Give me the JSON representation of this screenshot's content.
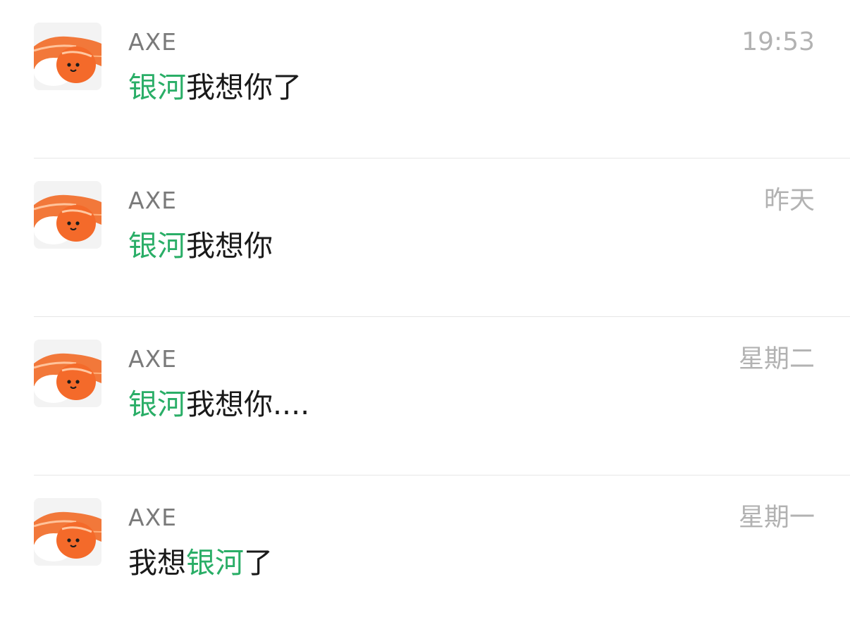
{
  "colors": {
    "highlight": "#2aae67",
    "sender": "#7a7a7a",
    "time": "#b2b2b2",
    "text": "#1a1a1a",
    "divider": "#e6e6e6"
  },
  "conversations": [
    {
      "avatar_icon": "salmon-sushi-avatar",
      "sender": "AXE",
      "time": "19:53",
      "message": [
        {
          "text": "银河",
          "highlight": true
        },
        {
          "text": "我想你了",
          "highlight": false
        }
      ]
    },
    {
      "avatar_icon": "salmon-sushi-avatar",
      "sender": "AXE",
      "time": "昨天",
      "message": [
        {
          "text": "银河",
          "highlight": true
        },
        {
          "text": "我想你",
          "highlight": false
        }
      ]
    },
    {
      "avatar_icon": "salmon-sushi-avatar",
      "sender": "AXE",
      "time": "星期二",
      "message": [
        {
          "text": "银河",
          "highlight": true
        },
        {
          "text": "我想你....",
          "highlight": false
        }
      ]
    },
    {
      "avatar_icon": "salmon-sushi-avatar",
      "sender": "AXE",
      "time": "星期一",
      "message": [
        {
          "text": "我想",
          "highlight": false
        },
        {
          "text": "银河",
          "highlight": true
        },
        {
          "text": "了",
          "highlight": false
        }
      ]
    }
  ]
}
